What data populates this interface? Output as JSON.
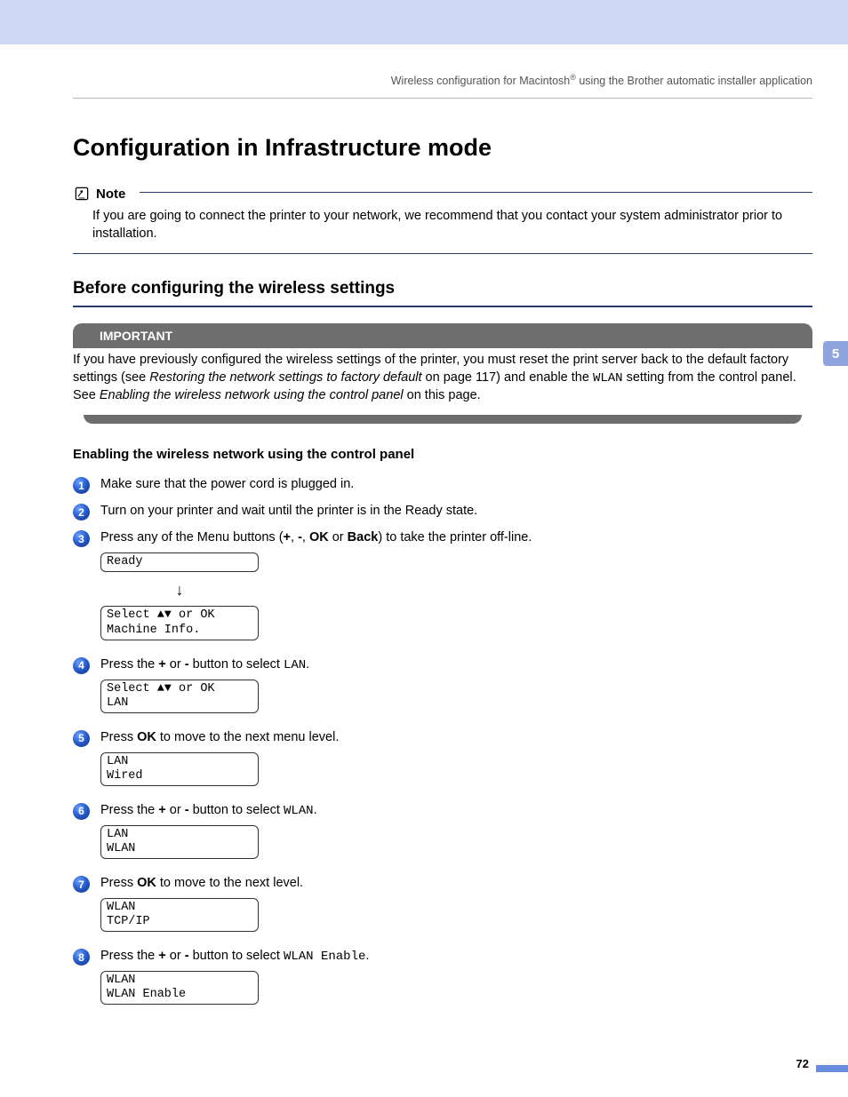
{
  "header": {
    "left": "Wireless configuration for Macintosh",
    "right": " using the Brother automatic installer application"
  },
  "title": "Configuration in Infrastructure mode",
  "note": {
    "label": "Note",
    "body": "If you are going to connect the printer to your network, we recommend that you contact your system administrator prior to installation."
  },
  "h2": "Before configuring the wireless settings",
  "important": {
    "label": "IMPORTANT",
    "p1a": "If you have previously configured the wireless settings of the printer, you must reset the print server back to the default factory settings (see ",
    "p1i": "Restoring the network settings to factory default",
    "p1b": " on page 117) and enable the ",
    "wlan": "WLAN",
    "p1c": " setting from the control panel. See ",
    "p1i2": "Enabling the wireless network using the control panel",
    "p1d": " on this page."
  },
  "h3": "Enabling the wireless network using the control panel",
  "steps": {
    "s1": {
      "num": "1",
      "text": "Make sure that the power cord is plugged in."
    },
    "s2": {
      "num": "2",
      "text": "Turn on your printer and wait until the printer is in the Ready state."
    },
    "s3": {
      "num": "3",
      "t1": "Press any of the Menu buttons (",
      "b1": "+",
      "c1": ", ",
      "b2": "-",
      "c2": ", ",
      "b3": "OK",
      "c3": " or ",
      "b4": "Back",
      "t2": ") to take the printer off-line.",
      "lcd1": "Ready",
      "lcd2": "Select ▲▼ or OK\nMachine Info."
    },
    "s4": {
      "num": "4",
      "t1": "Press the ",
      "b1": "+",
      "c1": " or ",
      "b2": "-",
      "t2": " button to select ",
      "m": "LAN",
      "t3": ".",
      "lcd": "Select ▲▼ or OK\nLAN"
    },
    "s5": {
      "num": "5",
      "t1": "Press ",
      "b1": "OK",
      "t2": " to move to the next menu level.",
      "lcd": "LAN\nWired"
    },
    "s6": {
      "num": "6",
      "t1": "Press the ",
      "b1": "+",
      "c1": " or ",
      "b2": "-",
      "t2": " button to select ",
      "m": "WLAN",
      "t3": ".",
      "lcd": "LAN\nWLAN"
    },
    "s7": {
      "num": "7",
      "t1": "Press ",
      "b1": "OK",
      "t2": " to move to the next level.",
      "lcd": "WLAN\nTCP/IP"
    },
    "s8": {
      "num": "8",
      "t1": "Press the ",
      "b1": "+",
      "c1": " or ",
      "b2": "-",
      "t2": " button to select  ",
      "m": "WLAN Enable",
      "t3": ".",
      "lcd": "WLAN\nWLAN Enable"
    }
  },
  "chapter": "5",
  "pageNumber": "72"
}
